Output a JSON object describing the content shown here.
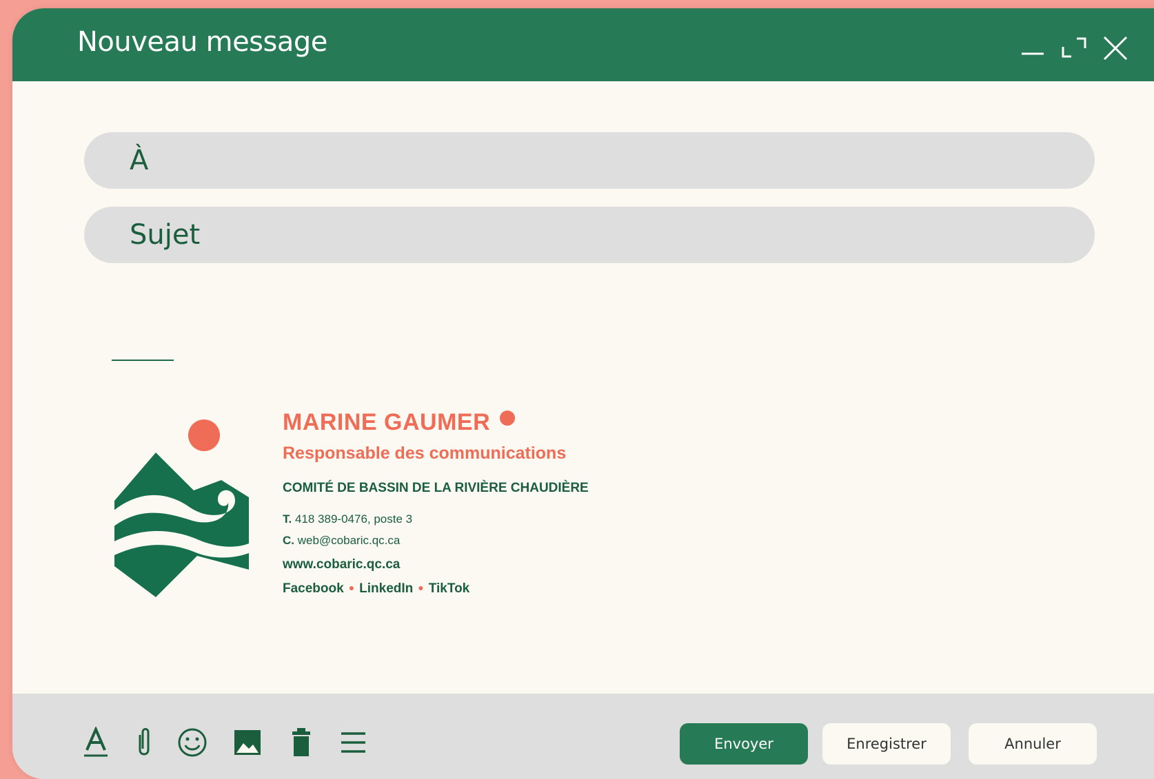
{
  "window": {
    "title": "Nouveau message",
    "controls": [
      "minimize-icon",
      "maximize-icon",
      "close-icon"
    ]
  },
  "fields": {
    "to_label": "À",
    "subject_label": "Sujet"
  },
  "signature": {
    "name": "MARINE GAUMER",
    "role": "Responsable des communications",
    "organization": "COMITÉ DE BASSIN DE LA RIVIÈRE CHAUDIÈRE",
    "phone_label": "T.",
    "phone": "418 389-0476, poste 3",
    "email_label": "C.",
    "email": "web@cobaric.qc.ca",
    "website": "www.cobaric.qc.ca",
    "social": [
      "Facebook",
      "LinkedIn",
      "TikTok"
    ]
  },
  "toolbar": {
    "icons": [
      "text-format-icon",
      "attachment-icon",
      "emoji-icon",
      "image-icon",
      "trash-icon",
      "menu-icon"
    ],
    "send_label": "Envoyer",
    "save_label": "Enregistrer",
    "cancel_label": "Annuler"
  },
  "colors": {
    "primary_green": "#267a55",
    "dark_green": "#1b5e3d",
    "accent_coral": "#ef6c57",
    "background": "#fbf9f1",
    "field_gray": "#dedede",
    "page_background": "#f59e94"
  }
}
